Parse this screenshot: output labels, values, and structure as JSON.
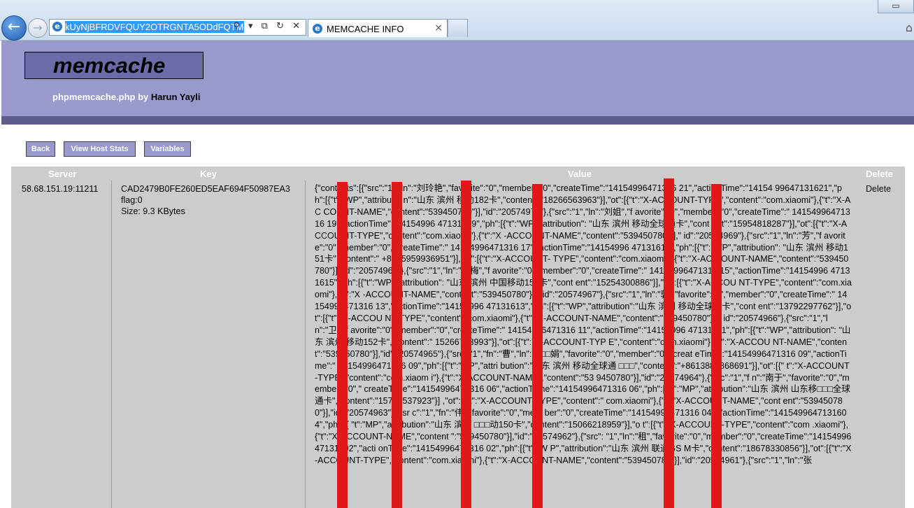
{
  "browser": {
    "url_text": "kUyNjBFRDVFQUY2OTRGNTA5ODdFQTM=",
    "address_tools": "⚲ ▾ ⧉ ↻ ✕",
    "tab_title": "MEMCACHE INFO",
    "tab_close": "×",
    "back_glyph": "←",
    "forward_glyph": "→",
    "window_controls": "▭",
    "home_glyph": "⌂"
  },
  "header": {
    "logo": "memcache",
    "byline_prefix": "phpmemcache.php by ",
    "author": "Harun Yayli"
  },
  "buttons": {
    "back": "Back",
    "host_stats": "View Host Stats",
    "variables": "Variables"
  },
  "table": {
    "headers": {
      "server": "Server",
      "key": "Key",
      "value": "Value",
      "delete": "Delete"
    },
    "row": {
      "server": "58.68.151.19:11211",
      "key": "CAD2479B0FE260ED5EAF694F50987EA3",
      "flag": "flag:0",
      "size": "Size: 9.3 KBytes",
      "delete": "Delete",
      "value": "{\"contacts\":[{\"src\":\"1\",\"ln\":\"刘玲艳\",\"favorite\":\"0\",\"member\":\"0\",\"createTime\":\"14154996471316 21\",\"actionTime\":\"14154 99647131621\",\"ph\":[{\"t\":\"WP\",\"attributio n\":\"山东 滨州 移动182卡\",\"content\":\"18266563963\"}],\"ot\":[{\"t\":\"X-ACCOUNT-TYPE\",\"content\":\"com.xiaomi\"},{\"t\":\"X-AC COUNT-NAME\",\"content\":\"539450780\"}],\"id\":\"20574970\"},{\"src\":\"1\",\"ln\":\"刘姐\",\"f avorite\":\"0\",\"member\":\"0\",\"createTime\":\" 14154996471316 19\",\"actionTime\":\"14154996 47131619\",\"ph\":[{\"t\":\"WP\",\"attribution\": \"山东 滨州 移动全球通卡\",\"cont ent\":\"15954818287\"}],\"ot\":[{\"t\":\"X-ACCOU NT-TYPE\",\"content\":\"com.xiaomi\"},{\"t\":\"X -ACCOUNT-NAME\",\"content\":\"539450780\"}],\" id\":\"20574969\"},{\"src\":\"1\",\"ln\":\"芳\",\"f avorite\":\"0\",\"member\":\"0\",\"createTime\":\" 14154996471316 17\",\"actionTime\":\"14154996 47131617\",\"ph\":[{\"t\":\"WP\",\"attribution\": \"山东 滨州 移动151卡\",\"content\":\" +8615959936951\"}],\"ot\":[{\"t\":\"X-ACCOUNT- TYPE\",\"content\":\"com.xiaomi\"},{\"t\":\"X-AC COUNT-NAME\",\"content\":\"539450780\"}],\"id\":\"20574968\"},{\"src\":\"1\",\"ln\":\"梅梅\",\"f avorite\":\"0\",\"member\":\"0\",\"createTime\":\" 14154996471316 15\",\"actionTime\":\"14154996 47131615\",\"ph\":[{\"t\":\"WP\",\"attribution\": \"山东 滨州 中国移动152卡\",\"cont ent\":\"15254300886\"}],\"ot\":[{\"t\":\"X-ACCOU NT-TYPE\",\"content\":\"com.xiaomi\"},{\"t\":\"X -ACCOUNT-NAME\",\"content\":\"539450780\"}],\" id\":\"20574967\"},{\"src\":\"1\",\"ln\":\"郭\",\"favorite\":\"0\",\"member\":\"0\",\"createTime\":\" 14154996471316 13\",\"actionTime\":\"14154996 47131613\",\"ph\":[{\"t\":\"WP\",\"attribution\":\"山东 滨州 移动全球通卡\",\"cont ent\":\"13792297762\"}],\"ot\":[{\"t\":\"X-ACCOU NT-TYPE\",\"content\":\"com.xiaomi\"},{\"t\":\"X-ACCOUNT-NAME\",\"content\":\"539450780\"}],\" id\":\"20574966\"},{\"src\":\"1\",\"ln\":\"卫\",\"f avorite\":\"0\",\"member\":\"0\",\"createTime\":\" 14154996471316 11\",\"actionTime\":\"14154996 47131611\",\"ph\":[{\"t\":\"WP\",\"attribution\": \"山东 滨州 移动152卡\",\"content\":\" 15266773993\"}],\"ot\":[{\"t\":\"X-ACCOUNT-TYP E\",\"content\":\"com.xiaomi\"},{\"t\":\"X-ACCOU NT-NAME\",\"content\":\"539450780\"}],\"id\":\"20574965\"},{\"src\":\"1\",\"fn\":\"曹\",\"ln\":\"□□□娟\",\"favorite\":\"0\",\"member\":\"0\",\"creat eTime\":\"14154996471316 09\",\"actionTime\":\" 14154996471316 09\",\"ph\":[{\"t\":\"MP\",\"attri bution\":\"山东 滨州 移动全球通 □□□\",\"content\":\"+8613884868691\"}],\"ot\":[{\" t\":\"X-ACCOUNT-TYPE\",\"content\":\"com.xiaom i\"},{\"t\":\"X-ACCOUNT-NAME\",\"content\":\"53 9450780\"}],\"id\":\"20574964\"},{\"src\":\"1\",\"f n\":\"南于\",\"favorite\":\"0\",\"member\":\"0\",\" createTime\":\"14154996471316 06\",\"actionT ime\":\"14154996471316 06\",\"ph\":[{\"t\":\"MP\",\"attribution\":\"山东 滨州 山东移□□□全球通卡\",\"content\":\"15715537923\"}] ,\"ot\":[{\"t\":\"X-ACCOUNT-TYPE\",\"content\":\" com.xiaomi\"},{\"t\":\"X-ACCOUNT-NAME\",\"cont ent\":\"539450780\"}],\"id\":\"20574963\"},{\"sr c\":\"1\",\"fn\":\"伟\",\"favorite\":\"0\",\"mem ber\":\"0\",\"createTime\":\"14154996471316 04\" ,\"actionTime\":\"1415499647131604\",\"ph\":[{ \"t\":\"MP\",\"attribution\":\"山东 滨州 □□□动150卡\",\"content\":\"15066218959\"}],\"o t\":[{\"t\":\"X-ACCOUNT-TYPE\",\"content\":\"com .xiaomi\"},{\"t\":\"X-ACCOUNT-NAME\",\"content \":\"539450780\"}],\"id\":\"20574962\"},{\"src\": \"1\",\"ln\":\"租\",\"favorite\":\"0\",\"member\":\"0\",\"createTime\":\"1415499647131602\",\"acti onTime\":\"14154996471316 02\",\"ph\":[{\"t\":\"W P\",\"attribution\":\"山东 滨州 联通GS M卡\",\"content\":\"18678330856\"}],\"ot\":[{\"t\":\"X-ACCOUNT-TYPE\",\"content\":\"com.xiaomi\"},{\"t\":\"X-ACCOUNT-NAME\",\"content\":\"539450780\"}],\"id\":\"20574961\"},{\"src\":\"1\",\"ln\":\"张"
    }
  },
  "colors": {
    "header_bg": "#9999cc",
    "header_bar": "#5c5c8a",
    "table_bg": "#cccccc",
    "redaction": "#e01818"
  }
}
